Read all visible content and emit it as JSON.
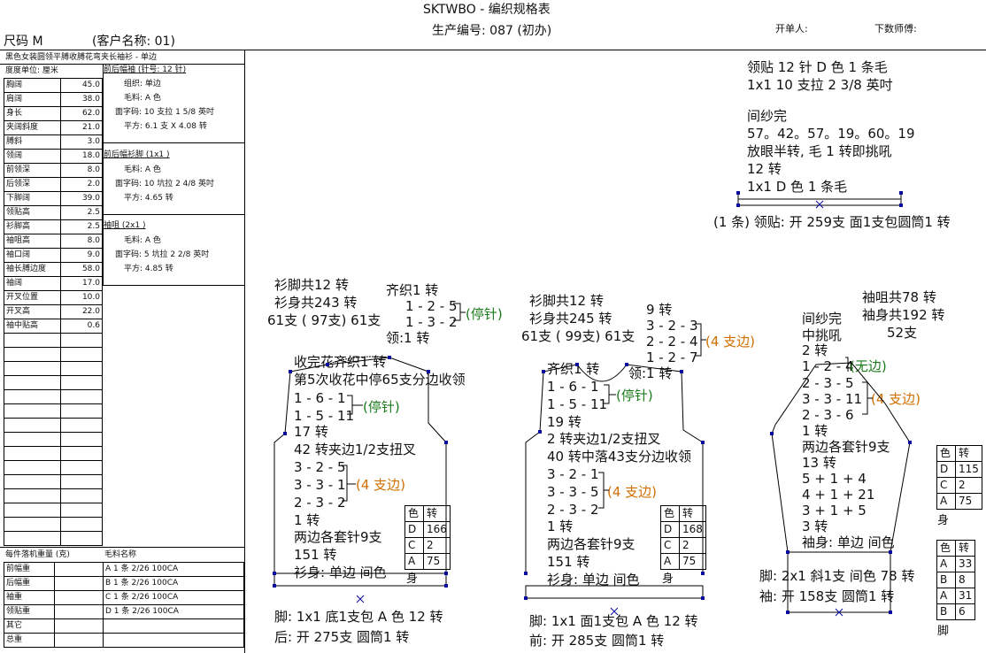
{
  "header": {
    "title": "SKTWBO - 编织规格表",
    "size": "尺码  M",
    "customer": "(客户名称: 01)",
    "prod_no": "生产编号: 087 (初办)",
    "issuer": "开单人:",
    "master": "下数师傅:"
  },
  "left_panel": {
    "style_name": "黑色女装圆领平膊收膊花弯夹长袖衫 - 单边",
    "unit": "度度单位: 厘米",
    "rows": [
      {
        "label": "胸阔",
        "value": "45.0"
      },
      {
        "label": "肩阔",
        "value": "38.0"
      },
      {
        "label": "身长",
        "value": "62.0"
      },
      {
        "label": "夹阔斜度",
        "value": "21.0"
      },
      {
        "label": "膊斜",
        "value": "3.0"
      },
      {
        "label": "领阔",
        "value": "18.0"
      },
      {
        "label": "前领深",
        "value": "8.0"
      },
      {
        "label": "后领深",
        "value": "2.0"
      },
      {
        "label": "下脚阔",
        "value": "39.0"
      },
      {
        "label": "领贴高",
        "value": "2.5"
      },
      {
        "label": "衫脚高",
        "value": "2.5"
      },
      {
        "label": "袖咀高",
        "value": "8.0"
      },
      {
        "label": "袖口阔",
        "value": "9.0"
      },
      {
        "label": "袖长膊边度",
        "value": "58.0"
      },
      {
        "label": "袖阔",
        "value": "17.0"
      },
      {
        "label": "开叉位置",
        "value": "10.0"
      },
      {
        "label": "开叉高",
        "value": "22.0"
      },
      {
        "label": "袖中贴高",
        "value": "0.6"
      }
    ],
    "section1_title": "前后幅袖 (针号: 12 针)",
    "section1_lines": [
      "组织: 单边",
      "毛料: A 色",
      "面字码: 10 支拉 1 5/8 英吋",
      "平方: 6.1 支 X  4.08 转"
    ],
    "section2_title": "前后幅衫脚 (1x1 )",
    "section2_lines": [
      "毛料: A 色",
      "面字码: 10 坑拉 2 4/8 英吋",
      "平方: 4.65 转"
    ],
    "section3_title": "袖咀 (2x1 )",
    "section3_lines": [
      "毛料: A 色",
      "面字码: 5 坑拉 2 2/8 英吋",
      "平方: 4.85 转"
    ],
    "machine_header": "每件落机重量 (克)",
    "yarn_header": "毛料名称",
    "machine_rows": [
      {
        "label": "前幅重",
        "yarn": "A  1 条 2/26 100CA"
      },
      {
        "label": "后幅重",
        "yarn": "B  1 条 2/26 100CA"
      },
      {
        "label": "袖重",
        "yarn": "C  1 条 2/26 100CA"
      },
      {
        "label": "领贴重",
        "yarn": "D  1 条 2/26 100CA"
      },
      {
        "label": "其它",
        "yarn": ""
      },
      {
        "label": "总重",
        "yarn": ""
      }
    ]
  },
  "collar": {
    "line1": "领贴  12 针 D 色 1 条毛",
    "line2": "1x1   10 支拉 2 3/8 英吋",
    "line3": "间纱完",
    "line4": "57。42。57。19。60。19",
    "line5": "放眼半转, 毛 1 转即挑吼",
    "line6": "12 转",
    "line7": "1x1   D 色 1 条毛",
    "bottom": "(1 条) 领贴: 开 259支 面1支包圆筒1 转"
  },
  "back": {
    "top1": "衫脚共12 转",
    "top2": "衫身共243 转",
    "top3": "61支 ( 97支) 61支",
    "neck1": "齐织1 转",
    "neck2": "1 - 2 - 5",
    "neck3": "1 - 3 - 2",
    "neck_tag": "(停针)",
    "neck4": "领:1 转",
    "l1": "收完花齐织1 转",
    "l2": "第5次收花中停65支分边收领",
    "l3": "1 - 6 - 1",
    "l4": "1 - 5 - 11",
    "l_tag": "(停针)",
    "l5": "17 转",
    "l6": "42 转夹边1/2支扭叉",
    "l7": "3 - 2 - 5",
    "l8": "3 - 3 - 1",
    "l9": "2 - 3 - 2",
    "l_tag2": "(4 支边)",
    "l10": "1 转",
    "l11": "两边各套针9支",
    "l12": "151 转",
    "l13": "衫身: 单边 间色",
    "body_label": "身",
    "table": [
      [
        "色",
        "转"
      ],
      [
        "D",
        "166"
      ],
      [
        "C",
        "2"
      ],
      [
        "A",
        "75"
      ]
    ],
    "foot1": "脚: 1x1   底1支包 A 色 12 转",
    "foot2": "后: 开 275支 圆筒1 转"
  },
  "front": {
    "top1": "衫脚共12 转",
    "top2": "衫身共245 转",
    "top3": "61支 ( 99支) 61支",
    "n1": "9 转",
    "n2": "3 - 2 - 3",
    "n3": "2 - 2 - 4",
    "n4": "1 - 2 - 7",
    "n_tag": "(4 支边)",
    "l1": "齐织1 转",
    "l1b": "领:1 转",
    "l2": "1 - 6 - 1",
    "l3": "1 - 5 - 11",
    "l_tag": "(停针)",
    "l4": "19 转",
    "l5": "2 转夹边1/2支扭叉",
    "l6": "40 转中落43支分边收领",
    "l7": "3 - 2 - 1",
    "l8": "3 - 3 - 5",
    "l9": "2 - 3 - 2",
    "l_tag2": "(4 支边)",
    "l10": "1 转",
    "l11": "两边各套针9支",
    "l12": "151 转",
    "l13": "衫身: 单边 间色",
    "body_label": "身",
    "table": [
      [
        "色",
        "转"
      ],
      [
        "D",
        "168"
      ],
      [
        "C",
        "2"
      ],
      [
        "A",
        "75"
      ]
    ],
    "foot1": "脚: 1x1   面1支包 A 色 12 转",
    "foot2": "前: 开 285支 圆筒1 转"
  },
  "sleeve": {
    "top1": "袖咀共78 转",
    "top2": "袖身共192 转",
    "top3": "52支",
    "l1": "间纱完",
    "l2": "中挑吼",
    "l3": "2 转",
    "l4": "1 - 2 - 4",
    "l4_tag": "(无边)",
    "l5": "2 - 3 - 5",
    "l6": "3 - 3 - 11",
    "l7": "2 - 3 - 6",
    "l_tag": "(4 支边)",
    "l8": "1 转",
    "l9": "两边各套针9支",
    "l10": "13 转",
    "l11": "5 + 1 + 4",
    "l12": "4 + 1 + 21",
    "l13": "3 + 1 + 5",
    "l14": "3 转",
    "l15": "袖身: 单边 间色",
    "foot1": "脚: 2x1   斜1支 间色 78 转",
    "foot2": "袖: 开 158支 圆筒1 转",
    "body_label": "身",
    "body_table": [
      [
        "色",
        "转"
      ],
      [
        "D",
        "115"
      ],
      [
        "C",
        "2"
      ],
      [
        "A",
        "75"
      ]
    ],
    "foot_label": "脚",
    "foot_table": [
      [
        "色",
        "转"
      ],
      [
        "A",
        "33"
      ],
      [
        "B",
        "8"
      ],
      [
        "A",
        "31"
      ],
      [
        "B",
        "6"
      ]
    ]
  }
}
